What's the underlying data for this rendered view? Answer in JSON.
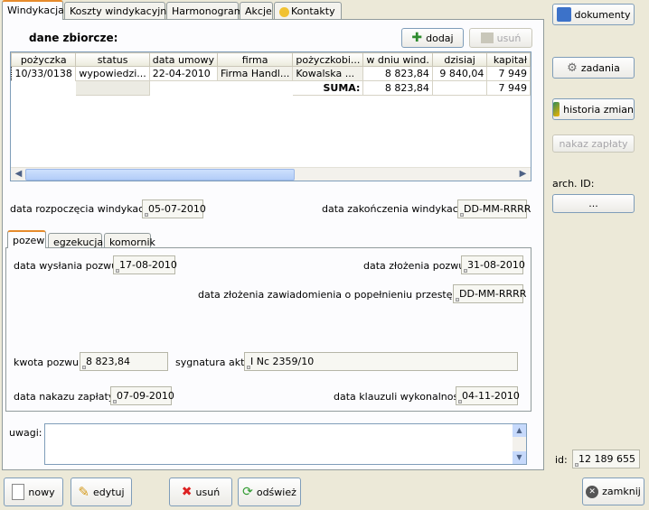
{
  "tabs": [
    "Windykacja",
    "Koszty windykacyjne",
    "Harmonogram",
    "Akcje",
    "Kontakty"
  ],
  "summary": {
    "title": "dane zbiorcze:",
    "add_label": "dodaj",
    "remove_label": "usuń",
    "columns": [
      "pożyczka",
      "status",
      "data umowy",
      "firma",
      "pożyczkobi...",
      "w dniu wind.",
      "dzisiaj",
      "kapitał"
    ],
    "row": [
      "10/33/0138",
      "wypowiedzi...",
      "22-04-2010",
      "Firma Handl...",
      "Kowalska ...",
      "8 823,84",
      "9 840,04",
      "7 949"
    ],
    "sum_label": "SUMA:",
    "sum_value": "8 823,84",
    "sum_capital": "7 949"
  },
  "start_label": "data rozpoczęcia windykacji:",
  "start_value": "05-07-2010",
  "end_label": "data zakończenia windykacji:",
  "end_value": "DD-MM-RRRR",
  "subtabs": [
    "pozew",
    "egzekucja",
    "komornik"
  ],
  "pozew": {
    "sent_label": "data wysłania pozwu:",
    "sent_value": "17-08-2010",
    "filed_label": "data złożenia pozwu:",
    "filed_value": "31-08-2010",
    "notice_label": "data złożenia zawiadomienia o popełnieniu przestępstwa:",
    "notice_value": "DD-MM-RRRR",
    "amount_label": "kwota pozwu:",
    "amount_value": "8 823,84",
    "sig_label": "sygnatura akt:",
    "sig_value": "I Nc 2359/10",
    "order_label": "data nakazu zapłaty:",
    "order_value": "07-09-2010",
    "clause_label": "data klauzuli wykonalności:",
    "clause_value": "04-11-2010"
  },
  "notes_label": "uwagi:",
  "right": {
    "documents": "dokumenty",
    "tasks": "zadania",
    "history": "historia zmian",
    "payment_order": "nakaz zapłaty",
    "arch_label": "arch. ID:",
    "arch_button": "...",
    "id_label": "id:",
    "id_value": "12 189 655",
    "close": "zamknij"
  },
  "bottom": {
    "new": "nowy",
    "edit": "edytuj",
    "delete": "usuń",
    "refresh": "odśwież"
  }
}
